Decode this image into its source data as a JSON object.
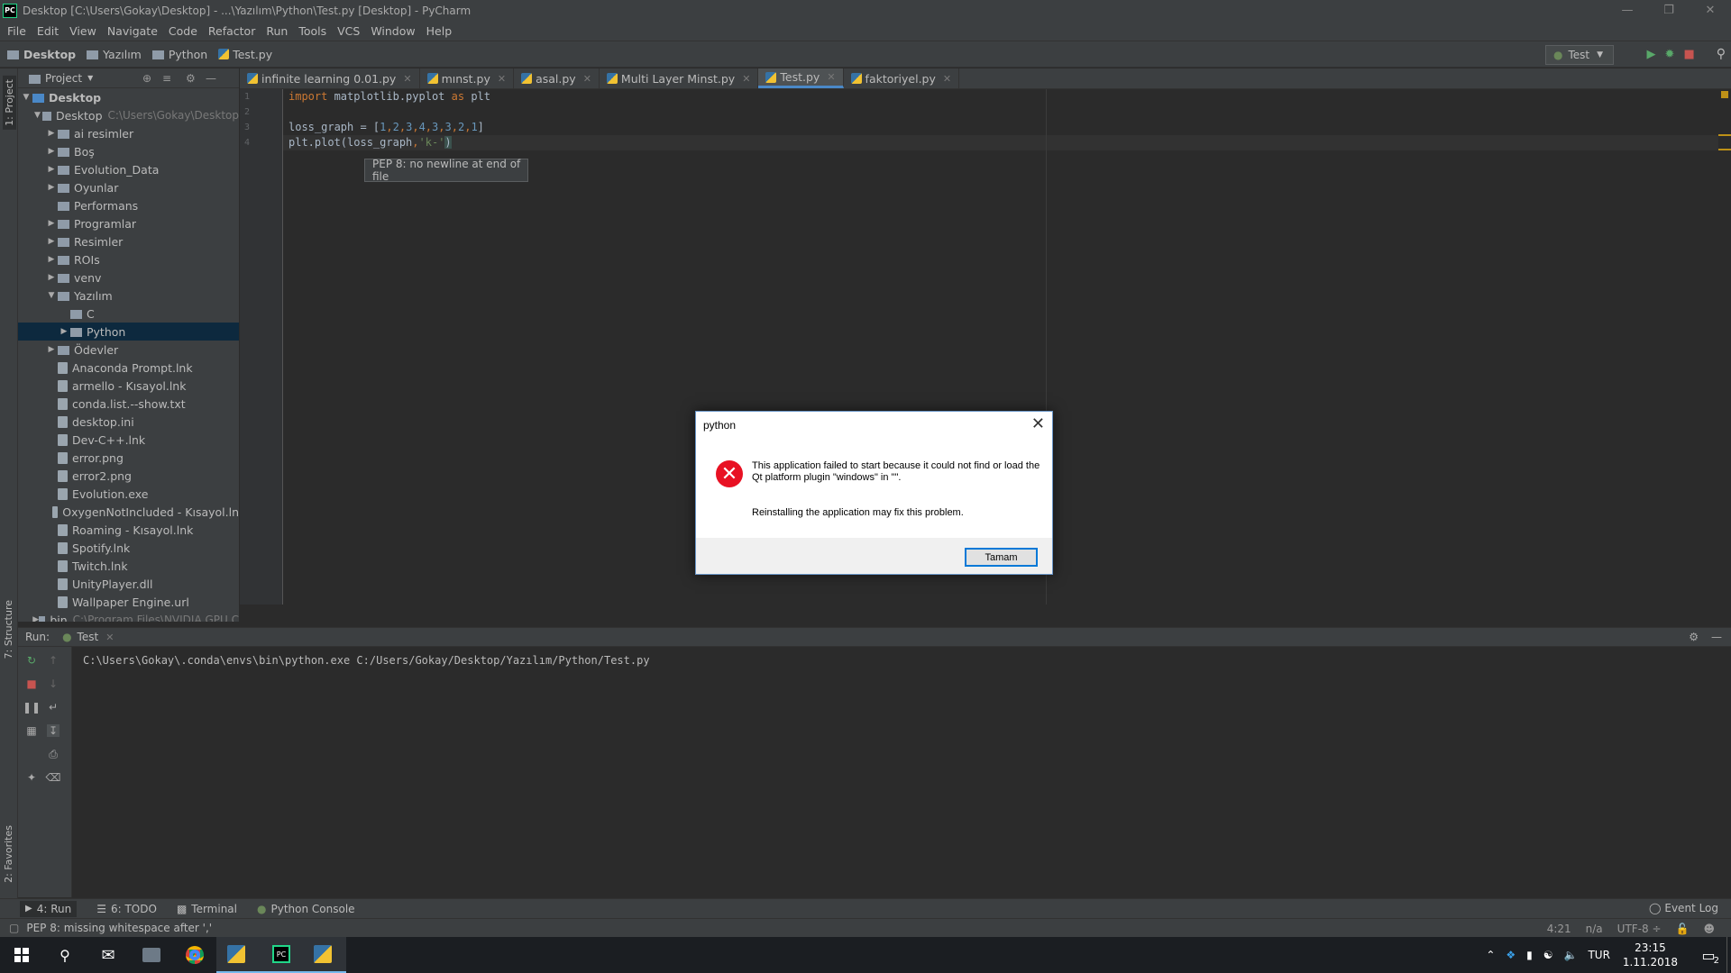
{
  "window": {
    "title": "Desktop [C:\\Users\\Gokay\\Desktop] - ...\\Yazılım\\Python\\Test.py [Desktop] - PyCharm",
    "logo": "PC"
  },
  "menu": [
    "File",
    "Edit",
    "View",
    "Navigate",
    "Code",
    "Refactor",
    "Run",
    "Tools",
    "VCS",
    "Window",
    "Help"
  ],
  "breadcrumbs": [
    "Desktop",
    "Yazılım",
    "Python",
    "Test.py"
  ],
  "run_config": "Test",
  "project_panel": {
    "title": "Project",
    "side_label": "1: Project",
    "structure_label": "7: Structure",
    "favorites_label": "2: Favorites",
    "root": {
      "name": "Desktop"
    },
    "desktop_node": {
      "name": "Desktop",
      "path": "C:\\Users\\Gokay\\Desktop"
    },
    "items": [
      {
        "name": "ai resimler",
        "type": "folder",
        "depth": 2,
        "expand": "collapsed"
      },
      {
        "name": "Boş",
        "type": "folder",
        "depth": 2,
        "expand": "collapsed"
      },
      {
        "name": "Evolution_Data",
        "type": "folder",
        "depth": 2,
        "expand": "collapsed"
      },
      {
        "name": "Oyunlar",
        "type": "folder",
        "depth": 2,
        "expand": "collapsed"
      },
      {
        "name": "Performans",
        "type": "folder",
        "depth": 2,
        "expand": "none"
      },
      {
        "name": "Programlar",
        "type": "folder",
        "depth": 2,
        "expand": "collapsed"
      },
      {
        "name": "Resimler",
        "type": "folder",
        "depth": 2,
        "expand": "collapsed"
      },
      {
        "name": "ROIs",
        "type": "folder",
        "depth": 2,
        "expand": "collapsed"
      },
      {
        "name": "venv",
        "type": "folder",
        "depth": 2,
        "expand": "collapsed"
      },
      {
        "name": "Yazılım",
        "type": "folder",
        "depth": 2,
        "expand": "expanded"
      },
      {
        "name": "C",
        "type": "folder",
        "depth": 3,
        "expand": "none"
      },
      {
        "name": "Python",
        "type": "folder",
        "depth": 3,
        "expand": "collapsed",
        "selected": true
      },
      {
        "name": "Ödevler",
        "type": "folder",
        "depth": 2,
        "expand": "collapsed"
      },
      {
        "name": "Anaconda Prompt.lnk",
        "type": "file",
        "depth": 2,
        "expand": "none"
      },
      {
        "name": "armello - Kısayol.lnk",
        "type": "file",
        "depth": 2,
        "expand": "none"
      },
      {
        "name": "conda.list.--show.txt",
        "type": "file",
        "depth": 2,
        "expand": "none"
      },
      {
        "name": "desktop.ini",
        "type": "file",
        "depth": 2,
        "expand": "none"
      },
      {
        "name": "Dev-C++.lnk",
        "type": "file",
        "depth": 2,
        "expand": "none"
      },
      {
        "name": "error.png",
        "type": "file",
        "depth": 2,
        "expand": "none"
      },
      {
        "name": "error2.png",
        "type": "file",
        "depth": 2,
        "expand": "none"
      },
      {
        "name": "Evolution.exe",
        "type": "file",
        "depth": 2,
        "expand": "none"
      },
      {
        "name": "OxygenNotIncluded - Kısayol.ln",
        "type": "file",
        "depth": 2,
        "expand": "none"
      },
      {
        "name": "Roaming - Kısayol.lnk",
        "type": "file",
        "depth": 2,
        "expand": "none"
      },
      {
        "name": "Spotify.lnk",
        "type": "file",
        "depth": 2,
        "expand": "none"
      },
      {
        "name": "Twitch.lnk",
        "type": "file",
        "depth": 2,
        "expand": "none"
      },
      {
        "name": "UnityPlayer.dll",
        "type": "file",
        "depth": 2,
        "expand": "none"
      },
      {
        "name": "Wallpaper Engine.url",
        "type": "file",
        "depth": 2,
        "expand": "none"
      },
      {
        "name": "bin",
        "path": "C:\\Program Files\\NVIDIA GPU C",
        "type": "folder",
        "depth": 1,
        "expand": "collapsed"
      }
    ]
  },
  "tabs": [
    {
      "label": "infinite learning 0.01.py",
      "active": false
    },
    {
      "label": "mınst.py",
      "active": false
    },
    {
      "label": "asal.py",
      "active": false
    },
    {
      "label": "Multi Layer Minst.py",
      "active": false
    },
    {
      "label": "Test.py",
      "active": true
    },
    {
      "label": "faktoriyel.py",
      "active": false
    }
  ],
  "editor": {
    "line_numbers": [
      "1",
      "2",
      "3",
      "4"
    ],
    "line1": {
      "kw1": "import",
      "mid": " matplotlib.pyplot ",
      "kw2": "as",
      "end": " plt"
    },
    "line3": {
      "prefix": "loss_graph = [",
      "nums": [
        "1",
        "2",
        "3",
        "4",
        "3",
        "3",
        "2",
        "1"
      ],
      "suffix": "]"
    },
    "line4": {
      "prefix": "plt.plot(loss_graph",
      "comma": ",",
      "str": "'k-'",
      "suffix": ")"
    },
    "tooltip": "PEP 8: no newline at end of file"
  },
  "run_panel": {
    "label": "Run:",
    "tab": "Test",
    "output": "C:\\Users\\Gokay\\.conda\\envs\\bin\\python.exe C:/Users/Gokay/Desktop/Yazılım/Python/Test.py"
  },
  "bottom_tools": [
    {
      "label": "4: Run",
      "icon": "play-icon"
    },
    {
      "label": "6: TODO",
      "icon": "list-icon"
    },
    {
      "label": "Terminal",
      "icon": "terminal-icon"
    },
    {
      "label": "Python Console",
      "icon": "python-icon"
    }
  ],
  "event_log": "Event Log",
  "status": {
    "message": "PEP 8: missing whitespace after ','",
    "position": "4:21",
    "separator": "n/a",
    "encoding": "UTF-8 ÷"
  },
  "dialog": {
    "title": "python",
    "message": "This application failed to start because it could not find or load the Qt platform plugin \"windows\" in \"\".",
    "hint": "Reinstalling the application may fix this problem.",
    "ok": "Tamam"
  },
  "taskbar": {
    "language": "TUR",
    "time": "23:15",
    "date": "1.11.2018",
    "notifications": "2"
  }
}
